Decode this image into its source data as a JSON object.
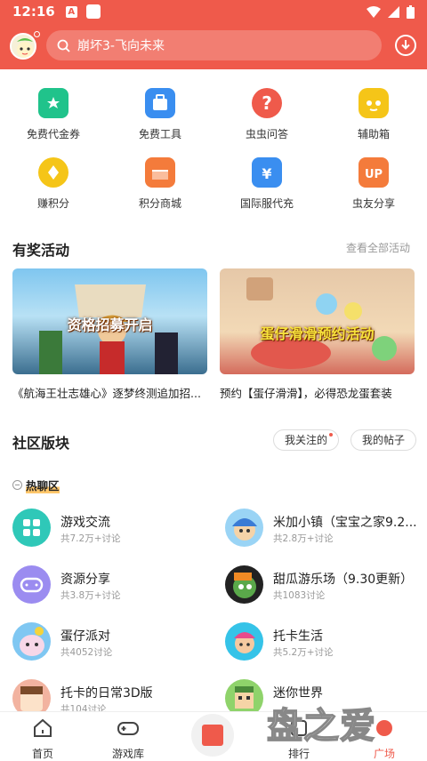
{
  "status_bar": {
    "time": "12:16",
    "notif_a": "A"
  },
  "search": {
    "placeholder": "崩坏3-飞向未来"
  },
  "quick_icons": [
    {
      "label": "免费代金券",
      "icon": "ticket-icon",
      "color": "#20c38b"
    },
    {
      "label": "免费工具",
      "icon": "toolbox-icon",
      "color": "#3a8ef0"
    },
    {
      "label": "虫虫问答",
      "icon": "question-icon",
      "color": "#ef5a4b"
    },
    {
      "label": "辅助箱",
      "icon": "robot-icon",
      "color": "#f5c518"
    },
    {
      "label": "赚积分",
      "icon": "coin-icon",
      "color": "#f5c518"
    },
    {
      "label": "积分商城",
      "icon": "shop-icon",
      "color": "#f47b3b"
    },
    {
      "label": "国际服代充",
      "icon": "yen-wallet-icon",
      "color": "#3a8ef0"
    },
    {
      "label": "虫友分享",
      "icon": "share-up-icon",
      "color": "#f47b3b"
    }
  ],
  "activities": {
    "title": "有奖活动",
    "view_all": "查看全部活动",
    "items": [
      {
        "banner_text": "资格招募开启",
        "caption": "《航海王壮志雄心》逐梦终测追加招..."
      },
      {
        "banner_text": "蛋仔滑滑预约活动",
        "caption": "预约【蛋仔滑滑】，必得恐龙蛋套装"
      }
    ]
  },
  "community": {
    "title": "社区版块",
    "my_follow": "我关注的",
    "my_posts": "我的帖子",
    "hot_zone": "热聊区",
    "forums": [
      {
        "name": "游戏交流",
        "stats": "共7.2万+讨论"
      },
      {
        "name": "米加小镇（宝宝之家9.2...",
        "stats": "共2.8万+讨论"
      },
      {
        "name": "资源分享",
        "stats": "共3.8万+讨论"
      },
      {
        "name": "甜瓜游乐场（9.30更新）",
        "stats": "共1083讨论"
      },
      {
        "name": "蛋仔派对",
        "stats": "共4052讨论"
      },
      {
        "name": "托卡生活",
        "stats": "共5.2万+讨论"
      },
      {
        "name": "托卡的日常3D版",
        "stats": "共104讨论"
      },
      {
        "name": "迷你世界",
        "stats": ""
      }
    ]
  },
  "nav": {
    "home": "首页",
    "games": "游戏库",
    "rank": "排行",
    "plaza": "广场"
  },
  "watermark": "盘之爱"
}
